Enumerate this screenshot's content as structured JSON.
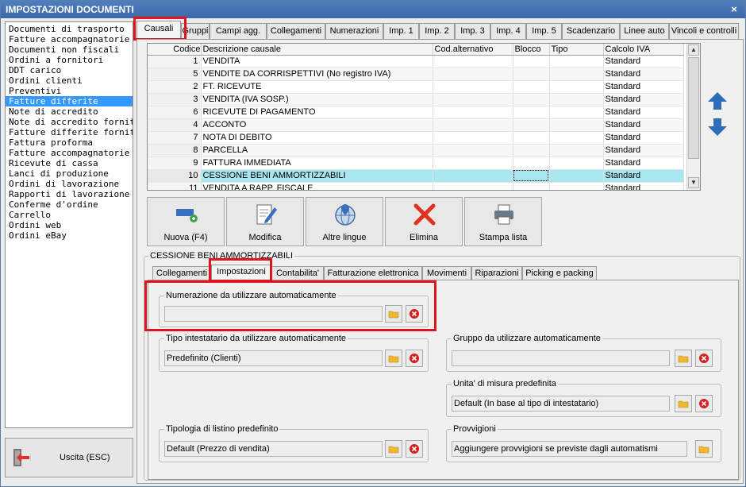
{
  "window": {
    "title": "IMPOSTAZIONI DOCUMENTI",
    "close_glyph": "×"
  },
  "left_list": {
    "items": [
      "Documenti di trasporto",
      "Fatture accompagnatorie",
      "Documenti non fiscali",
      "Ordini a fornitori",
      "DDT carico",
      "Ordini clienti",
      "Preventivi",
      "Fatture differite",
      "Note di accredito",
      "Note di accredito fornitori",
      "Fatture differite fornitori",
      "Fattura proforma",
      "Fatture accompagnatorie fc",
      "Ricevute di cassa",
      "Lanci di produzione",
      "Ordini di lavorazione",
      "Rapporti di lavorazione",
      "Conferme d'ordine",
      "Carrello",
      "Ordini web",
      "Ordini eBay"
    ],
    "selected_index": 7
  },
  "exit_button": {
    "label": "Uscita (ESC)",
    "icon": "exit-door-icon"
  },
  "top_tabs": [
    "Causali",
    "Gruppi",
    "Campi agg.",
    "Collegamenti",
    "Numerazioni",
    "Imp. 1",
    "Imp. 2",
    "Imp. 3",
    "Imp. 4",
    "Imp. 5",
    "Scadenzario",
    "Linee auto",
    "Vincoli e controlli"
  ],
  "top_tabs_active": 0,
  "grid": {
    "columns": [
      "Codice",
      "Descrizione causale",
      "Cod.alternativo",
      "Blocco",
      "Tipo",
      "Calcolo IVA"
    ],
    "rows": [
      [
        "1",
        "VENDITA",
        "",
        "",
        "",
        "Standard"
      ],
      [
        "5",
        "VENDITE DA CORRISPETTIVI (No registro IVA)",
        "",
        "",
        "",
        "Standard"
      ],
      [
        "2",
        "FT. RICEVUTE",
        "",
        "",
        "",
        "Standard"
      ],
      [
        "3",
        "VENDITA (IVA SOSP.)",
        "",
        "",
        "",
        "Standard"
      ],
      [
        "6",
        "RICEVUTE DI PAGAMENTO",
        "",
        "",
        "",
        "Standard"
      ],
      [
        "4",
        "ACCONTO",
        "",
        "",
        "",
        "Standard"
      ],
      [
        "7",
        "NOTA DI DEBITO",
        "",
        "",
        "",
        "Standard"
      ],
      [
        "8",
        "PARCELLA",
        "",
        "",
        "",
        "Standard"
      ],
      [
        "9",
        "FATTURA IMMEDIATA",
        "",
        "",
        "",
        "Standard"
      ],
      [
        "10",
        "CESSIONE BENI AMMORTIZZABILI",
        "",
        "",
        "",
        "Standard"
      ],
      [
        "11",
        "VENDITA A RAPP. FISCALE",
        "",
        "",
        "",
        "Standard"
      ]
    ],
    "selected_row": 9
  },
  "toolbar": {
    "buttons": [
      {
        "label": "Nuova (F4)",
        "icon": "new-record-icon"
      },
      {
        "label": "Modifica",
        "icon": "edit-document-icon"
      },
      {
        "label": "Altre lingue",
        "icon": "globe-language-icon"
      },
      {
        "label": "Elimina",
        "icon": "delete-x-icon"
      },
      {
        "label": "Stampa lista",
        "icon": "printer-icon"
      }
    ]
  },
  "detail": {
    "caption": "CESSIONE BENI AMMORTIZZABILI",
    "tabs": [
      "Collegamenti",
      "Impostazioni",
      "Contabilita'",
      "Fatturazione elettronica",
      "Movimenti",
      "Riparazioni",
      "Picking e packing"
    ],
    "active_tab": 1,
    "groups": {
      "numerazione": {
        "label": "Numerazione da utilizzare automaticamente",
        "value": ""
      },
      "tipo_intestatario": {
        "label": "Tipo intestatario da utilizzare automaticamente",
        "value": "Predefinito (Clienti)"
      },
      "gruppo": {
        "label": "Gruppo da utilizzare automaticamente",
        "value": ""
      },
      "unita_misura": {
        "label": "Unita' di misura predefinita",
        "value": "Default (In base al tipo di intestatario)"
      },
      "listino": {
        "label": "Tipologia di listino predefinito",
        "value": "Default (Prezzo di vendita)"
      },
      "provvigioni": {
        "label": "Provvigioni",
        "value": "Aggiungere provvigioni se previste dagli automatismi"
      }
    }
  },
  "colors": {
    "selection": "#3399ff",
    "row_highlight": "#a8e6f0",
    "annotation_red": "#e0141e",
    "titlebar": "#3b69a9"
  }
}
